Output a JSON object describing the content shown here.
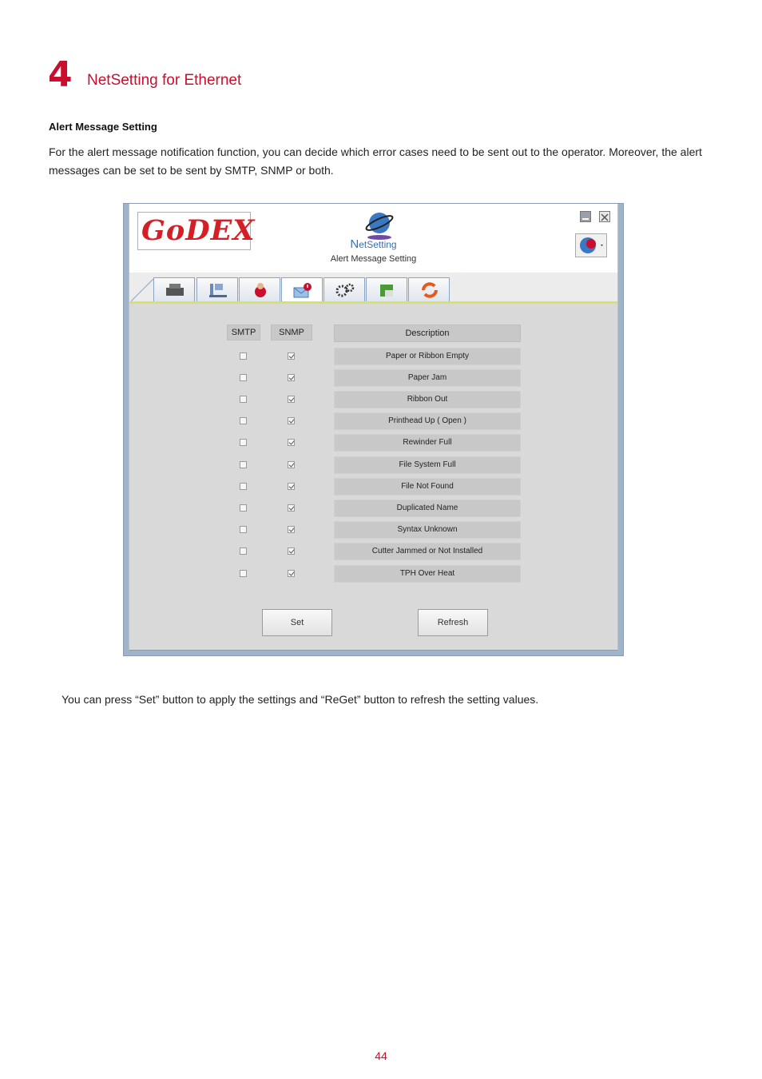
{
  "chapter": {
    "number": "4",
    "title": "NetSetting for Ethernet"
  },
  "section": {
    "heading": "Alert Message Setting"
  },
  "intro": "For the alert message notification function, you can decide which error cases need to be sent out to the operator. Moreover, the alert messages can be set to be sent by SMTP, SNMP or both.",
  "app": {
    "logo_text": "GoDEX",
    "brand_initial": "N",
    "brand_rest": "etSetting",
    "subtitle": "Alert Message Setting",
    "columns": {
      "smtp": "SMTP",
      "snmp": "SNMP",
      "description": "Description"
    },
    "rows": [
      {
        "description": "Paper or Ribbon Empty",
        "smtp": false,
        "snmp": true
      },
      {
        "description": "Paper Jam",
        "smtp": false,
        "snmp": true
      },
      {
        "description": "Ribbon Out",
        "smtp": false,
        "snmp": true
      },
      {
        "description": "Printhead Up ( Open )",
        "smtp": false,
        "snmp": true
      },
      {
        "description": "Rewinder Full",
        "smtp": false,
        "snmp": true
      },
      {
        "description": "File System Full",
        "smtp": false,
        "snmp": true
      },
      {
        "description": "File Not Found",
        "smtp": false,
        "snmp": true
      },
      {
        "description": "Duplicated Name",
        "smtp": false,
        "snmp": true
      },
      {
        "description": "Syntax Unknown",
        "smtp": false,
        "snmp": true
      },
      {
        "description": "Cutter Jammed or Not Installed",
        "smtp": false,
        "snmp": true
      },
      {
        "description": "TPH Over Heat",
        "smtp": false,
        "snmp": true
      }
    ],
    "buttons": {
      "set": "Set",
      "refresh": "Refresh"
    },
    "tabs": [
      "printer-icon",
      "network-icon",
      "user-icon",
      "alert-mail-icon",
      "gears-icon",
      "key-icon",
      "refresh-icon"
    ],
    "colors": {
      "brand_red": "#d41f26",
      "accent_yellow": "#d7e26a",
      "link_blue": "#3a6fb5"
    }
  },
  "footer_note": "You can press “Set” button to apply the settings and “ReGet” button to refresh the setting values.",
  "page_number": "44"
}
